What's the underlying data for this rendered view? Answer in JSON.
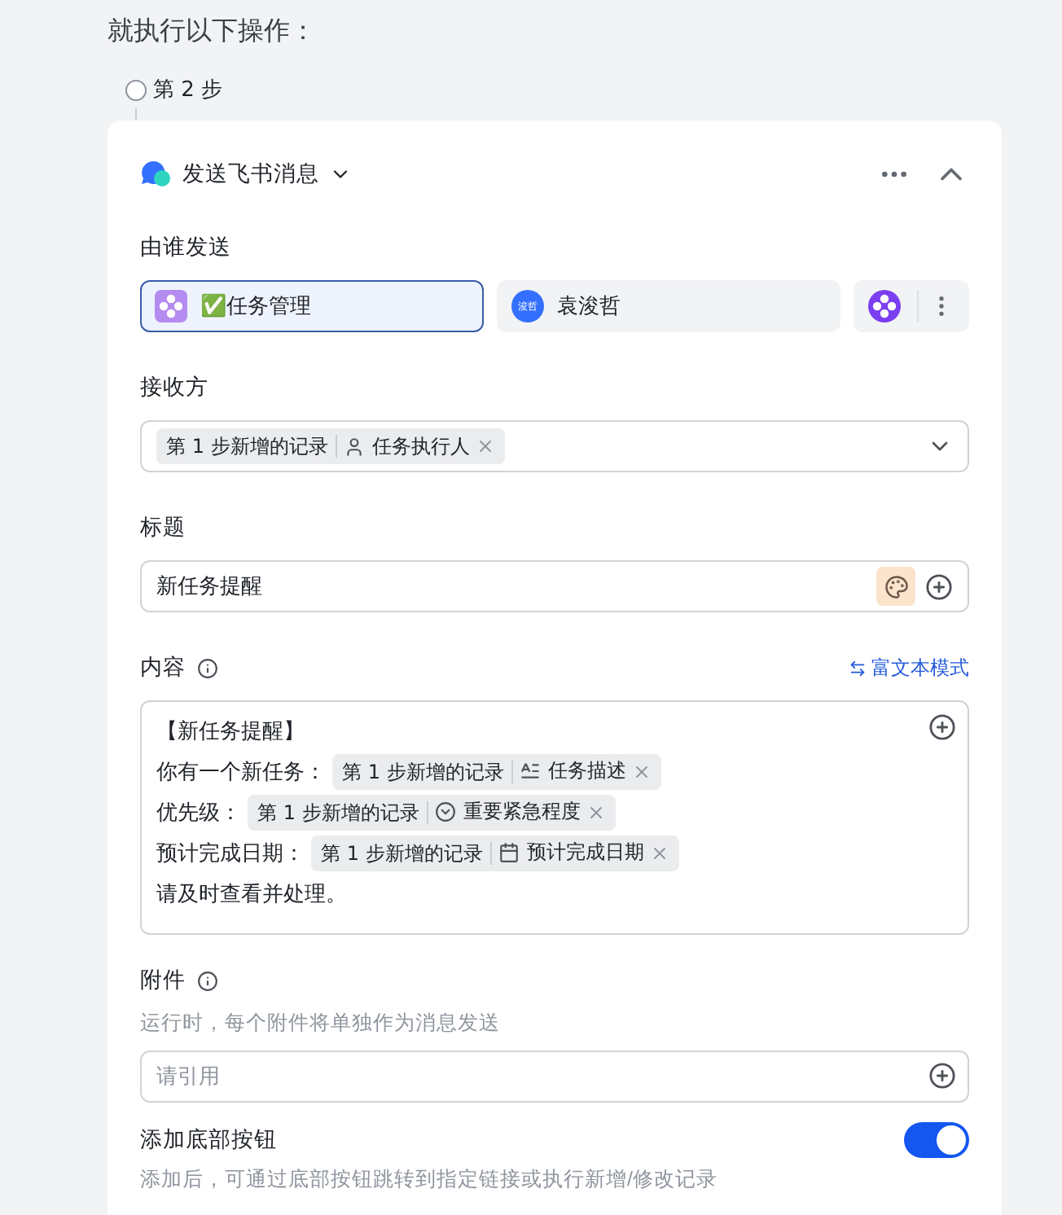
{
  "heading": "就执行以下操作：",
  "step": {
    "label": "第 2 步"
  },
  "action": {
    "name": "发送飞书消息"
  },
  "sender": {
    "label": "由谁发送",
    "options": [
      {
        "kind": "app",
        "name": "✅任务管理",
        "selected": true
      },
      {
        "kind": "user",
        "avatar": "浚哲",
        "name": "袁浚哲",
        "selected": false
      },
      {
        "kind": "icon",
        "selected": false
      }
    ]
  },
  "recipient": {
    "label": "接收方",
    "chips": [
      {
        "source": "第 1 步新增的记录",
        "field": {
          "kind": "person",
          "name": "任务执行人"
        }
      }
    ]
  },
  "title_field": {
    "label": "标题",
    "value": "新任务提醒"
  },
  "content": {
    "label": "内容",
    "mode_link": "富文本模式",
    "lines": [
      {
        "segments": [
          {
            "kind": "text",
            "text": "【新任务提醒】"
          }
        ]
      },
      {
        "segments": [
          {
            "kind": "text",
            "text": "你有一个新任务："
          },
          {
            "kind": "chip",
            "source": "第 1 步新增的记录",
            "field": {
              "kind": "text",
              "name": "任务描述"
            }
          }
        ]
      },
      {
        "segments": [
          {
            "kind": "text",
            "text": "优先级："
          },
          {
            "kind": "chip",
            "source": "第 1 步新增的记录",
            "field": {
              "kind": "select",
              "name": "重要紧急程度"
            }
          }
        ]
      },
      {
        "segments": [
          {
            "kind": "text",
            "text": "预计完成日期："
          },
          {
            "kind": "chip",
            "source": "第 1 步新增的记录",
            "field": {
              "kind": "date",
              "name": "预计完成日期"
            }
          }
        ]
      },
      {
        "segments": [
          {
            "kind": "text",
            "text": "请及时查看并处理。"
          }
        ]
      }
    ]
  },
  "attachment": {
    "label": "附件",
    "hint": "运行时，每个附件将单独作为消息发送",
    "placeholder": "请引用"
  },
  "footer_button": {
    "label": "添加底部按钮",
    "on": true,
    "hint": "添加后，可通过底部按钮跳转到指定链接或执行新增/修改记录"
  }
}
